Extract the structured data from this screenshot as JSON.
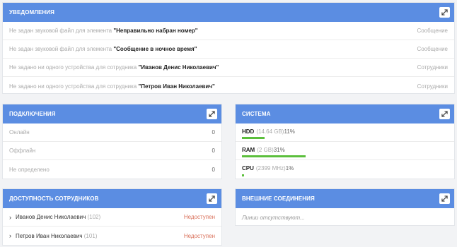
{
  "notifications": {
    "title": "Уведомления",
    "items": [
      {
        "prefix": "Не задан звуковой файл для элемента",
        "name": "\"Неправильно набран номер\"",
        "category": "Сообщение"
      },
      {
        "prefix": "Не задан звуковой файл для элемента",
        "name": "\"Сообщение в ночное время\"",
        "category": "Сообщение"
      },
      {
        "prefix": "Не задано ни одного устройства для сотрудника",
        "name": "\"Иванов Денис Николаевич\"",
        "category": "Сотрудники"
      },
      {
        "prefix": "Не задано ни одного устройства для сотрудника",
        "name": "\"Петров Иван Николаевич\"",
        "category": "Сотрудники"
      }
    ]
  },
  "connections": {
    "title": "Подключения",
    "items": [
      {
        "label": "Онлайн",
        "value": "0"
      },
      {
        "label": "Оффлайн",
        "value": "0"
      },
      {
        "label": "Не определено",
        "value": "0"
      }
    ]
  },
  "system": {
    "title": "Система",
    "items": [
      {
        "label": "HDD",
        "detail": "(14.64 GB)",
        "percent": "11%",
        "fill": 0.11
      },
      {
        "label": "RAM",
        "detail": "(2 GB)",
        "percent": "31%",
        "fill": 0.31
      },
      {
        "label": "CPU",
        "detail": "(2399 MHz)",
        "percent": "1%",
        "fill": 0.01
      }
    ],
    "bar_color": "#5bbf3c"
  },
  "availability": {
    "title": "Доступность сотрудников",
    "items": [
      {
        "name": "Иванов Денис Николаевич",
        "ext": "(102)",
        "status": "Недоступен"
      },
      {
        "name": "Петров Иван Николаевич",
        "ext": "(101)",
        "status": "Недоступен"
      }
    ]
  },
  "external": {
    "title": "Внешние соединения",
    "empty_text": "Линии отсутствуют..."
  },
  "colors": {
    "header": "#5b8de2",
    "unavailable": "#d9705a"
  },
  "icons": {
    "expand": "expand-arrows-icon",
    "chevron": "chevron-right-icon"
  }
}
